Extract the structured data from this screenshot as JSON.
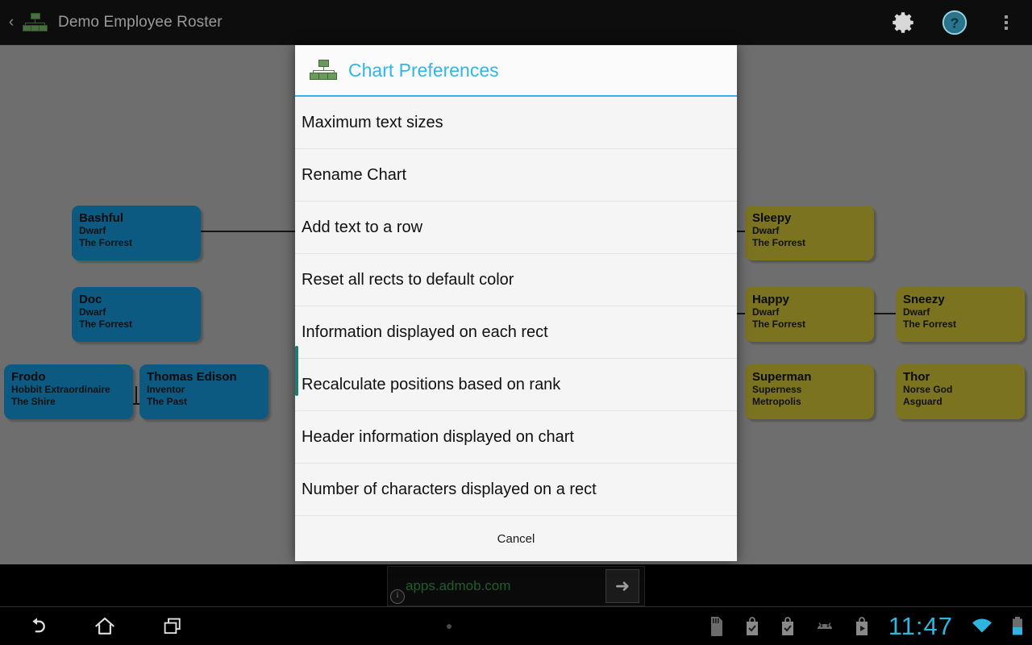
{
  "actionbar": {
    "up_glyph": "‹",
    "title": "Demo Employee Roster",
    "app_icon": "org-chart-icon",
    "settings_icon": "gear-icon",
    "help_icon": "help-circle-icon",
    "overflow_icon": "overflow-menu-icon"
  },
  "chart": {
    "nodes": [
      {
        "name": "Bashful",
        "title": "Dwarf",
        "location": "The Forrest",
        "color": "#0c5a82"
      },
      {
        "name": "Doc",
        "title": "Dwarf",
        "location": "The Forrest",
        "color": "#0c5a82"
      },
      {
        "name": "Frodo",
        "title": "Hobbit Extraordinaire",
        "location": "The Shire",
        "color": "#0c5a82"
      },
      {
        "name": "Thomas Edison",
        "title": "Inventor",
        "location": "The Past",
        "color": "#0c5a82"
      },
      {
        "name": "Sleepy",
        "title": "Dwarf",
        "location": "The Forrest",
        "color": "#7b7320"
      },
      {
        "name": "Happy",
        "title": "Dwarf",
        "location": "The Forrest",
        "color": "#7b7320"
      },
      {
        "name": "Sneezy",
        "title": "Dwarf",
        "location": "The Forrest",
        "color": "#7b7320"
      },
      {
        "name": "Superman",
        "title": "Superness",
        "location": "Metropolis",
        "color": "#7b7320"
      },
      {
        "name": "Thor",
        "title": "Norse God",
        "location": "Asguard",
        "color": "#7b7320"
      }
    ]
  },
  "dialog": {
    "icon": "org-chart-icon",
    "title": "Chart Preferences",
    "accent_color": "#33b5e5",
    "items": [
      {
        "label": "Maximum text sizes"
      },
      {
        "label": "Rename Chart"
      },
      {
        "label": "Add text to a row"
      },
      {
        "label": "Reset all rects to default color"
      },
      {
        "label": "Information displayed on each rect"
      },
      {
        "label": "Recalculate positions based on rank"
      },
      {
        "label": "Header information displayed on chart"
      },
      {
        "label": "Number of characters displayed on a rect"
      }
    ],
    "cancel_label": "Cancel"
  },
  "ad": {
    "url": "apps.admob.com",
    "go_glyph": "➜",
    "info_glyph": "i"
  },
  "navbar": {
    "back_icon": "back-arrow-icon",
    "home_icon": "home-icon",
    "recents_icon": "recent-apps-icon",
    "clock": "11:47",
    "status_icons": [
      "sd-card-icon",
      "download-bag-check-icon",
      "download-bag-check-icon",
      "android-head-icon",
      "play-store-icon"
    ],
    "wifi_icon": "wifi-icon",
    "battery_icon": "battery-icon"
  }
}
